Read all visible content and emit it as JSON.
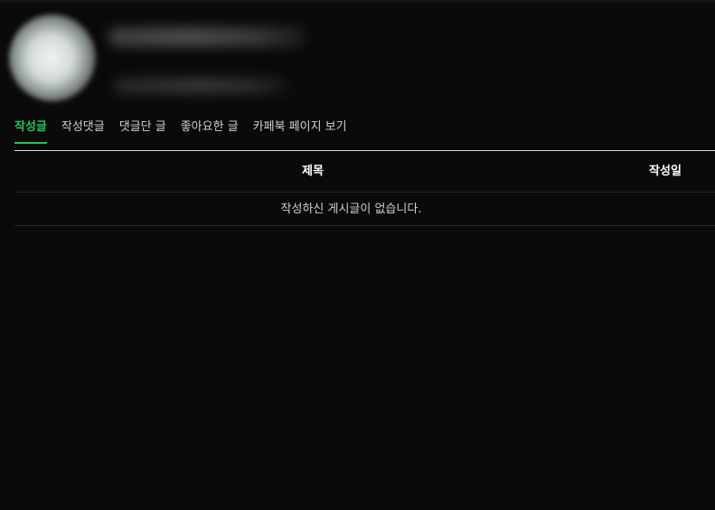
{
  "tabs": [
    {
      "label": "작성글",
      "active": true
    },
    {
      "label": "작성댓글",
      "active": false
    },
    {
      "label": "댓글단 글",
      "active": false
    },
    {
      "label": "좋아요한 글",
      "active": false
    },
    {
      "label": "카페북 페이지 보기",
      "active": false
    }
  ],
  "table": {
    "headers": {
      "title": "제목",
      "date": "작성일"
    },
    "empty_message": "작성하신 게시글이 없습니다."
  },
  "colors": {
    "background": "#0a0a0a",
    "accent": "#21c35b"
  }
}
